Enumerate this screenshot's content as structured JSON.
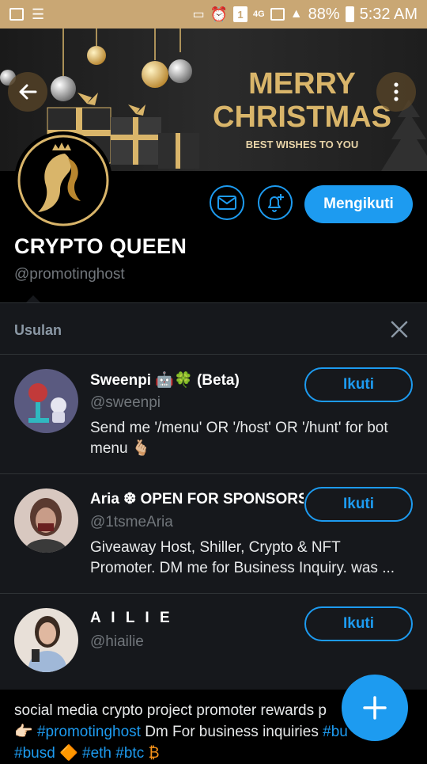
{
  "status": {
    "battery": "88%",
    "time": "5:32 AM",
    "network": "4G",
    "sim": "1"
  },
  "banner": {
    "line1": "MERRY",
    "line2": "CHRISTMAS",
    "line3": "BEST WISHES TO YOU"
  },
  "profile": {
    "name": "CRYPTO QUEEN",
    "handle": "@promotinghost",
    "follow_label": "Mengikuti"
  },
  "suggestions": {
    "title": "Usulan",
    "items": [
      {
        "name": "Sweenpi 🤖🍀 (Beta)",
        "handle": "@sweenpi",
        "bio_line1": "Send me '/menu' OR '/host' OR '/hunt' for bot",
        "bio_line2": "menu 🫰🏼",
        "button": "Ikuti"
      },
      {
        "name": "Aria ❆ OPEN FOR SPONSORS",
        "handle": "@1tsmeAria",
        "bio_line1": "Giveaway Host, Shiller, Crypto & NFT",
        "bio_line2": "Promoter. DM me for Business Inquiry. was ...",
        "button": "Ikuti"
      },
      {
        "name": "A I L I E",
        "handle": "@hiailie",
        "bio_line1": "",
        "bio_line2": "",
        "button": "Ikuti"
      }
    ]
  },
  "bio": {
    "line1": "social media crypto project promoter rewards p",
    "line2_emoji": "👉🏻",
    "line2_tag": "#promotinghost",
    "line2_text": "Dm For business inquiries",
    "line2_tag2": "#bu",
    "line3_tag1": "#busd",
    "line3_sym": "🔶",
    "line3_tag2": "#eth",
    "line3_tag3": "#btc",
    "line3_sym2": "₿"
  },
  "colors": {
    "accent": "#1d9bf0",
    "statusbar": "#c9a774",
    "gold": "#d9b56a"
  }
}
